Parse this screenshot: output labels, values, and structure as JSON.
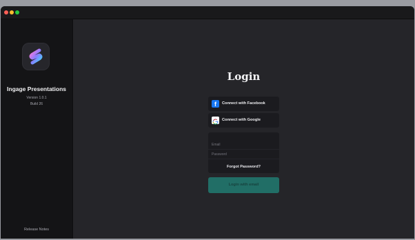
{
  "window": {
    "traffic_lights": [
      "close",
      "minimize",
      "zoom"
    ]
  },
  "sidebar": {
    "app_icon": "ingage-logo-icon",
    "app_name": "Ingage Presentations",
    "version": "Version 1.0.1",
    "build": "Build 26",
    "release_notes": "Release Notes"
  },
  "login": {
    "title": "Login",
    "facebook_label": "Connect with Facebook",
    "google_label": "Connect with Google",
    "email_placeholder": "Email",
    "password_placeholder": "Password",
    "forgot_password": "Forgot Password?",
    "login_email_label": "Login with email"
  },
  "colors": {
    "accent": "#216e66",
    "background": "#252529",
    "sidebar": "#141416",
    "facebook": "#1877f2"
  }
}
